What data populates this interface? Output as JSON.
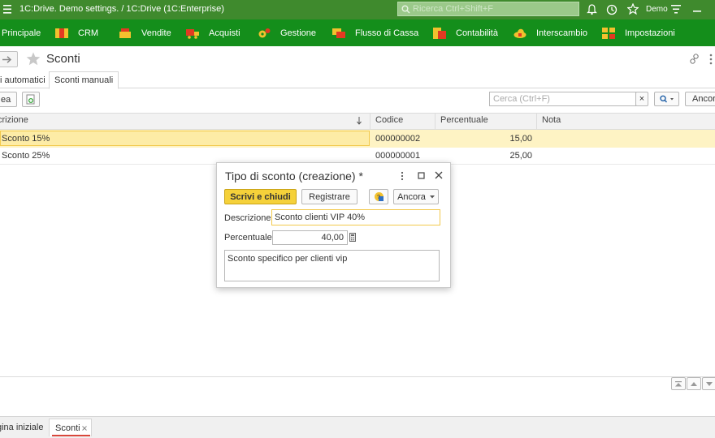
{
  "titlebar": {
    "title": "1C:Drive. Demo settings. / 1C:Drive  (1C:Enterprise)",
    "search_placeholder": "Ricerca Ctrl+Shift+F",
    "user": "Demo"
  },
  "menu": [
    {
      "label": "Principale"
    },
    {
      "label": "CRM"
    },
    {
      "label": "Vendite"
    },
    {
      "label": "Acquisti"
    },
    {
      "label": "Gestione"
    },
    {
      "label": "Flusso di Cassa"
    },
    {
      "label": "Contabilità"
    },
    {
      "label": "Interscambio"
    },
    {
      "label": "Impostazioni"
    }
  ],
  "page": {
    "title": "Sconti",
    "tabs": [
      "i automatici",
      "Sconti manuali"
    ],
    "create_label": "ea",
    "search_placeholder": "Cerca (Ctrl+F)",
    "clear_glyph": "×",
    "more_label": "Ancor"
  },
  "table": {
    "columns": [
      "crizione",
      "Codice",
      "Percentuale",
      "Nota"
    ],
    "rows": [
      {
        "descr": "Sconto 15%",
        "code": "000000002",
        "perc": "15,00",
        "note": ""
      },
      {
        "descr": "Sconto 25%",
        "code": "000000001",
        "perc": "25,00",
        "note": ""
      }
    ]
  },
  "dialog": {
    "title": "Tipo di sconto (creazione) *",
    "write_close": "Scrivi e chiudi",
    "register": "Registrare",
    "more": "Ancora",
    "descr_label": "Descrizione:",
    "descr_value": "Sconto clienti VIP 40%",
    "perc_label": "Percentuale:",
    "perc_value": "40,00",
    "comment": "Sconto specifico per clienti vip"
  },
  "bottom_tabs": [
    "gina iniziale",
    "Sconti"
  ],
  "colors": {
    "titlebar": "#3f8a2d",
    "menubar": "#148e1b",
    "accent": "#f5d13a",
    "selected_row": "#fef3c4"
  }
}
